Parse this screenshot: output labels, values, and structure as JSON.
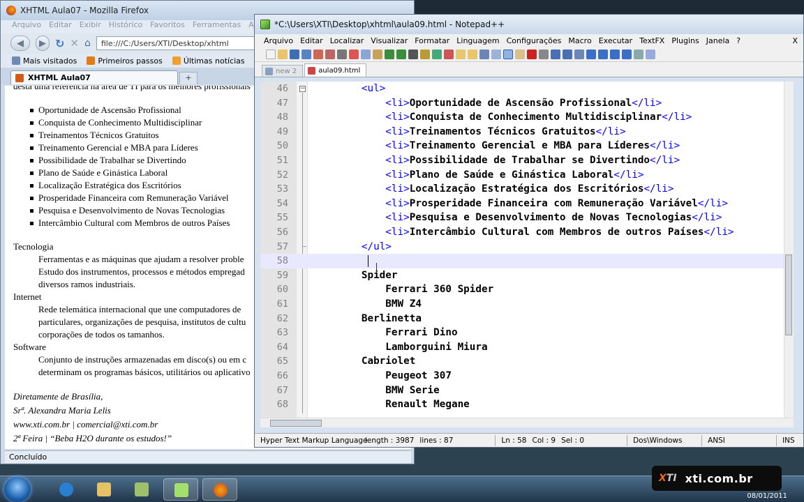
{
  "firefox": {
    "title": "XHTML Aula07 - Mozilla Firefox",
    "menu": [
      "Arquivo",
      "Editar",
      "Exibir",
      "Histórico",
      "Favoritos",
      "Ferramentas",
      "Ajuda"
    ],
    "url": "file:///C:/Users/XTI/Desktop/xhtml",
    "bookmarks": [
      "Mais visitados",
      "Primeiros passos",
      "Últimas notícias"
    ],
    "tab_label": "XHTML Aula07",
    "new_tab": "+",
    "content": {
      "cut_text": "desta uma referência na área de TI para os melhores profissionais",
      "list": [
        "Oportunidade de Ascensão Profissional",
        "Conquista de Conhecimento Multidisciplinar",
        "Treinamentos Técnicos Gratuitos",
        "Treinamento Gerencial e MBA para Líderes",
        "Possibilidade de Trabalhar se Divertindo",
        "Plano de Saúde e Ginástica Laboral",
        "Localização Estratégica dos Escritórios",
        "Prosperidade Financeira com Remuneração Variável",
        "Pesquisa e Desenvolvimento de Novas Tecnologias",
        "Intercâmbio Cultural com Membros de outros Países"
      ],
      "definitions": [
        {
          "term": "Tecnologia",
          "lines": [
            "Ferramentas e as máquinas que ajudam a resolver proble",
            "Estudo dos instrumentos, processos e métodos empregad",
            "diversos ramos industriais."
          ]
        },
        {
          "term": "Internet",
          "lines": [
            "Rede telemática internacional que une computadores de",
            "particulares, organizações de pesquisa, institutos de cultu",
            "corporações de todos os tamanhos."
          ]
        },
        {
          "term": "Software",
          "lines": [
            "Conjunto de instruções armazenadas em disco(s) ou em c",
            "determinam os programas básicos, utilitários ou aplicativo"
          ]
        }
      ],
      "signature": [
        "Diretamente de Brasília,",
        "Srª. Alexandra Maria Lelis",
        "www.xti.com.br | comercial@xti.com.br",
        "2ª Feira | “Beba H2O durante os estudos!”"
      ]
    },
    "status": "Concluído"
  },
  "notepad": {
    "title": "*C:\\Users\\XTI\\Desktop\\xhtml\\aula09.html - Notepad++",
    "menu": [
      "Arquivo",
      "Editar",
      "Localizar",
      "Visualizar",
      "Formatar",
      "Linguagem",
      "Configurações",
      "Macro",
      "Executar",
      "TextFX",
      "Plugins",
      "Janela",
      "?"
    ],
    "close_x": "X",
    "tabs": [
      "new 2",
      "aula09.html"
    ],
    "lines": [
      {
        "n": "46",
        "text": "<ul>"
      },
      {
        "n": "47",
        "text": "    <li>Oportunidade de Ascensão Profissional</li>"
      },
      {
        "n": "48",
        "text": "    <li>Conquista de Conhecimento Multidisciplinar</li>"
      },
      {
        "n": "49",
        "text": "    <li>Treinamentos Técnicos Gratuitos</li>"
      },
      {
        "n": "50",
        "text": "    <li>Treinamento Gerencial e MBA para Líderes</li>"
      },
      {
        "n": "51",
        "text": "    <li>Possibilidade de Trabalhar se Divertindo</li>"
      },
      {
        "n": "52",
        "text": "    <li>Plano de Saúde e Ginástica Laboral</li>"
      },
      {
        "n": "53",
        "text": "    <li>Localização Estratégica dos Escritórios</li>"
      },
      {
        "n": "54",
        "text": "    <li>Prosperidade Financeira com Remuneração Variável</li>"
      },
      {
        "n": "55",
        "text": "    <li>Pesquisa e Desenvolvimento de Novas Tecnologias</li>"
      },
      {
        "n": "56",
        "text": "    <li>Intercâmbio Cultural com Membros de outros Países</li>"
      },
      {
        "n": "57",
        "text": "</ul>"
      },
      {
        "n": "58",
        "text": ""
      },
      {
        "n": "59",
        "text": "Spider"
      },
      {
        "n": "60",
        "text": "    Ferrari 360 Spider"
      },
      {
        "n": "61",
        "text": "    BMW Z4"
      },
      {
        "n": "62",
        "text": "Berlinetta"
      },
      {
        "n": "63",
        "text": "    Ferrari Dino"
      },
      {
        "n": "64",
        "text": "    Lamborguini Miura"
      },
      {
        "n": "65",
        "text": "Cabriolet"
      },
      {
        "n": "66",
        "text": "    Peugeot 307"
      },
      {
        "n": "67",
        "text": "    BMW Serie"
      },
      {
        "n": "68",
        "text": "    Renault Megane"
      }
    ],
    "status": {
      "lang": "Hyper Text Markup Language",
      "length": "length : 3987",
      "lines": "lines : 87",
      "ln": "Ln : 58",
      "col": "Col : 9",
      "sel": "Sel : 0",
      "eol": "Dos\\Windows",
      "enc": "ANSI",
      "mode": "INS"
    }
  },
  "brand": {
    "logo_x": "X",
    "logo_rest": "TI",
    "site": "xti.com.br"
  },
  "date": "08/01/2011",
  "colors": {
    "tag_blue": "#0000ff",
    "current_line": "#e8e8ff",
    "brand_orange": "#e36a14"
  }
}
